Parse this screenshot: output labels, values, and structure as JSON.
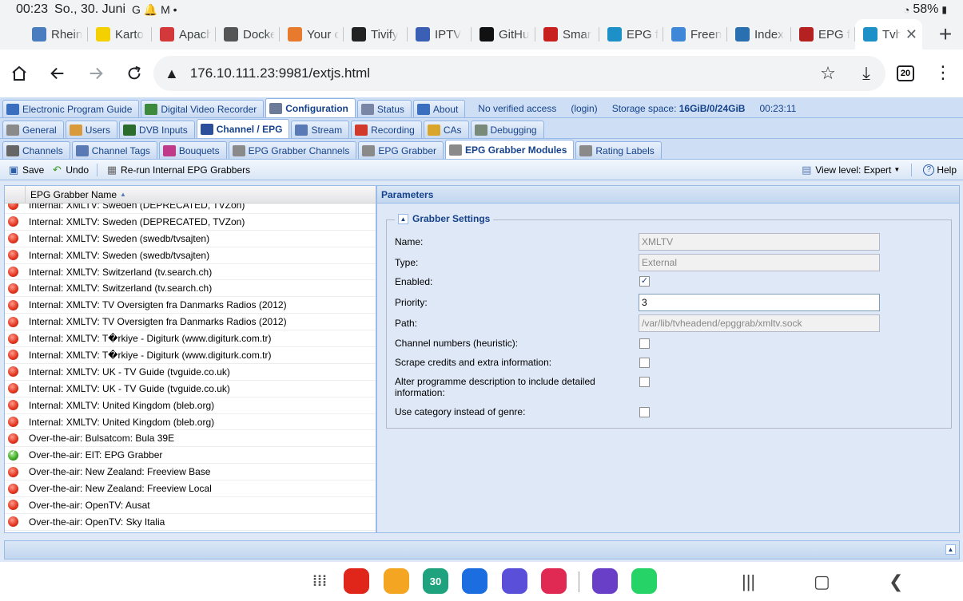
{
  "statusbar": {
    "time": "00:23",
    "date": "So., 30. Juni",
    "notif_icons": "G 🔔 M •",
    "battery": "58%"
  },
  "browser_tabs": [
    {
      "label": "Rhein",
      "icon": "rhein-icon",
      "color": "#4a7dbf"
    },
    {
      "label": "Karto",
      "icon": "smiley-icon",
      "color": "#f4d000"
    },
    {
      "label": "Apach",
      "icon": "apache-icon",
      "color": "#d3393b"
    },
    {
      "label": "Docke",
      "icon": "docker-icon",
      "color": "#555555"
    },
    {
      "label": "Your c",
      "icon": "cloud-icon",
      "color": "#e87a2d"
    },
    {
      "label": "Tivify",
      "icon": "tivify-icon",
      "color": "#222222"
    },
    {
      "label": "IPTV",
      "icon": "cube-icon",
      "color": "#3a5fb5"
    },
    {
      "label": "GitHu",
      "icon": "github-icon",
      "color": "#111111"
    },
    {
      "label": "Smar",
      "icon": "smart-icon",
      "color": "#c8201e"
    },
    {
      "label": "EPG f",
      "icon": "kodi-icon",
      "color": "#1e90c8"
    },
    {
      "label": "Freen",
      "icon": "freenet-icon",
      "color": "#3f88d8"
    },
    {
      "label": "Index",
      "icon": "index-icon",
      "color": "#2a6fb0"
    },
    {
      "label": "EPG f",
      "icon": "epg-icon",
      "color": "#b52020"
    },
    {
      "label": "Tvh",
      "icon": "kodi-icon",
      "color": "#1e90c8",
      "active": true
    }
  ],
  "toolbar": {
    "url": "176.10.111.23:9981/extjs.html",
    "tab_count": "20"
  },
  "app": {
    "main_tabs": [
      {
        "label": "Electronic Program Guide",
        "icon": "epg-icon",
        "color": "#3a6ebf"
      },
      {
        "label": "Digital Video Recorder",
        "icon": "dvr-icon",
        "color": "#3d8a3d"
      },
      {
        "label": "Configuration",
        "icon": "wrench-icon",
        "color": "#6b7a99",
        "active": true
      },
      {
        "label": "Status",
        "icon": "eye-icon",
        "color": "#7a86a6"
      },
      {
        "label": "About",
        "icon": "info-icon",
        "color": "#3a6ebf"
      }
    ],
    "access_status": "No verified access",
    "login": "(login)",
    "storage_label": "Storage space:",
    "storage_value": "16GiB/0/24GiB",
    "clock": "00:23:11",
    "config_tabs": [
      {
        "label": "General",
        "icon": "tools-icon",
        "color": "#8a8a8a"
      },
      {
        "label": "Users",
        "icon": "users-icon",
        "color": "#d99a3b"
      },
      {
        "label": "DVB Inputs",
        "icon": "tv-icon",
        "color": "#2b6b2b"
      },
      {
        "label": "Channel / EPG",
        "icon": "tv-icon",
        "color": "#2b4f9b",
        "active": true
      },
      {
        "label": "Stream",
        "icon": "stream-icon",
        "color": "#5a7ab5"
      },
      {
        "label": "Recording",
        "icon": "recording-icon",
        "color": "#d13a2a"
      },
      {
        "label": "CAs",
        "icon": "key-icon",
        "color": "#d9a62b"
      },
      {
        "label": "Debugging",
        "icon": "bug-icon",
        "color": "#7a8a7a"
      }
    ],
    "channel_tabs": [
      {
        "label": "Channels",
        "icon": "remote-icon",
        "color": "#666666"
      },
      {
        "label": "Channel Tags",
        "icon": "tags-icon",
        "color": "#5a7ab5"
      },
      {
        "label": "Bouquets",
        "icon": "bouquet-icon",
        "color": "#c03a8a"
      },
      {
        "label": "EPG Grabber Channels",
        "icon": "grabber-icon",
        "color": "#8a8a8a"
      },
      {
        "label": "EPG Grabber",
        "icon": "grabber-icon",
        "color": "#8a8a8a"
      },
      {
        "label": "EPG Grabber Modules",
        "icon": "grabber-icon",
        "color": "#8a8a8a",
        "active": true
      },
      {
        "label": "Rating Labels",
        "icon": "rating-icon",
        "color": "#8a8a8a"
      }
    ],
    "actions": {
      "save": "Save",
      "undo": "Undo",
      "rerun": "Re-run Internal EPG Grabbers",
      "view_level": "View level: Expert",
      "help": "Help"
    },
    "grid": {
      "header": "EPG Grabber Name",
      "rows": [
        {
          "name": "Internal: XMLTV: Sweden (DEPRECATED, TVZon)",
          "status": "red"
        },
        {
          "name": "Internal: XMLTV: Sweden (DEPRECATED, TVZon)",
          "status": "red"
        },
        {
          "name": "Internal: XMLTV: Sweden (swedb/tvsajten)",
          "status": "red"
        },
        {
          "name": "Internal: XMLTV: Sweden (swedb/tvsajten)",
          "status": "red"
        },
        {
          "name": "Internal: XMLTV: Switzerland (tv.search.ch)",
          "status": "red"
        },
        {
          "name": "Internal: XMLTV: Switzerland (tv.search.ch)",
          "status": "red"
        },
        {
          "name": "Internal: XMLTV: TV Oversigten fra Danmarks Radios (2012)",
          "status": "red"
        },
        {
          "name": "Internal: XMLTV: TV Oversigten fra Danmarks Radios (2012)",
          "status": "red"
        },
        {
          "name": "Internal: XMLTV: T�rkiye - Digiturk (www.digiturk.com.tr)",
          "status": "red"
        },
        {
          "name": "Internal: XMLTV: T�rkiye - Digiturk (www.digiturk.com.tr)",
          "status": "red"
        },
        {
          "name": "Internal: XMLTV: UK - TV Guide (tvguide.co.uk)",
          "status": "red"
        },
        {
          "name": "Internal: XMLTV: UK - TV Guide (tvguide.co.uk)",
          "status": "red"
        },
        {
          "name": "Internal: XMLTV: United Kingdom (bleb.org)",
          "status": "red"
        },
        {
          "name": "Internal: XMLTV: United Kingdom (bleb.org)",
          "status": "red"
        },
        {
          "name": "Over-the-air: Bulsatcom: Bula 39E",
          "status": "red"
        },
        {
          "name": "Over-the-air: EIT: EPG Grabber",
          "status": "green"
        },
        {
          "name": "Over-the-air: New Zealand: Freeview Base",
          "status": "red"
        },
        {
          "name": "Over-the-air: New Zealand: Freeview Local",
          "status": "red"
        },
        {
          "name": "Over-the-air: OpenTV: Ausat",
          "status": "red"
        },
        {
          "name": "Over-the-air: OpenTV: Sky Italia",
          "status": "red"
        }
      ]
    },
    "params": {
      "title": "Parameters",
      "section": "Grabber Settings",
      "name_label": "Name:",
      "name_value": "XMLTV",
      "type_label": "Type:",
      "type_value": "External",
      "enabled_label": "Enabled:",
      "enabled": true,
      "priority_label": "Priority:",
      "priority_value": "3",
      "path_label": "Path:",
      "path_value": "/var/lib/tvheadend/epggrab/xmltv.sock",
      "channel_numbers_label": "Channel numbers (heuristic):",
      "scrape_label": "Scrape credits and extra information:",
      "alter_label": "Alter programme description to include detailed information:",
      "category_label": "Use category instead of genre:"
    }
  },
  "dock": [
    {
      "name": "app-drawer-icon",
      "color": "#ffffff"
    },
    {
      "name": "flipboard-icon",
      "color": "#e0251b"
    },
    {
      "name": "files-icon",
      "color": "#f4a623"
    },
    {
      "name": "calendar-icon",
      "color": "#1fa37e",
      "label": "30"
    },
    {
      "name": "messages-icon",
      "color": "#1c6de0"
    },
    {
      "name": "internet-icon",
      "color": "#5a4fd8"
    },
    {
      "name": "screen-recorder-icon",
      "color": "#e02a54"
    },
    {
      "name": "email-icon",
      "color": "#6a3fc8"
    },
    {
      "name": "whatsapp-icon",
      "color": "#25d366"
    }
  ]
}
